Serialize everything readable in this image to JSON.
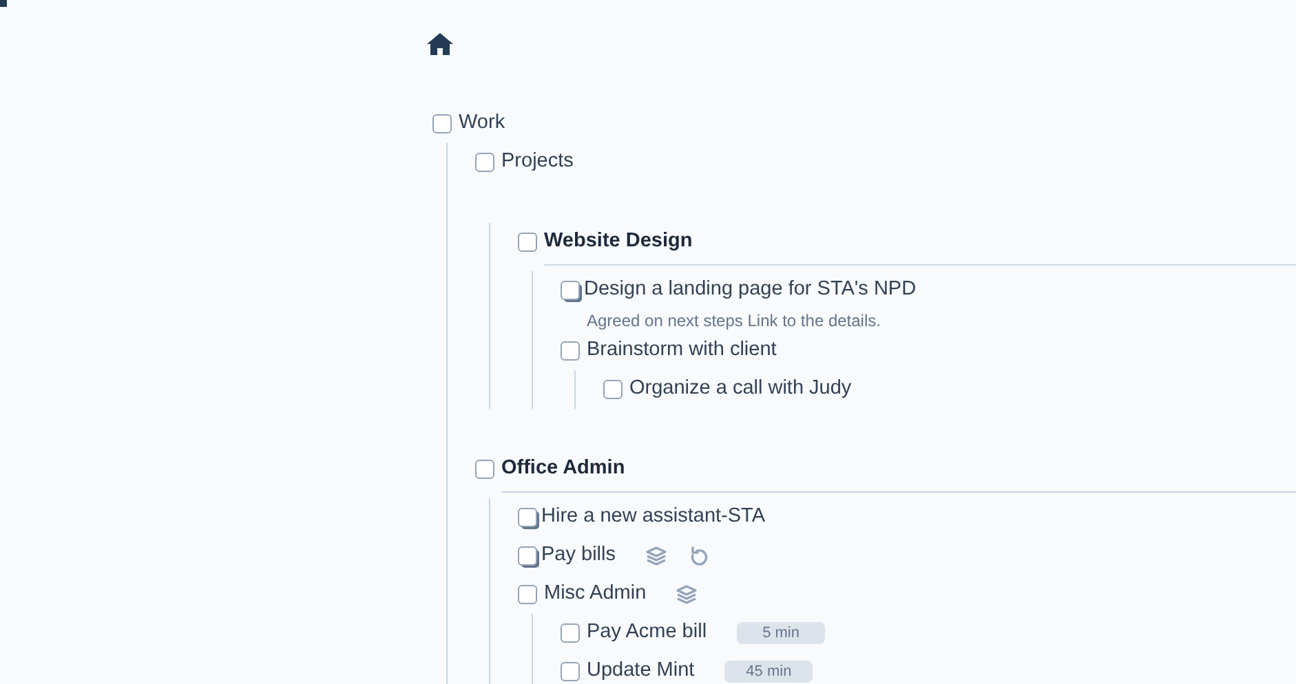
{
  "tree": [
    {
      "label": "Work",
      "kind": "task",
      "checked": false,
      "children": [
        {
          "label": "Projects",
          "kind": "task",
          "checked": false,
          "children": [
            {
              "label": "Website Design",
              "kind": "section",
              "checked": false,
              "children": [
                {
                  "label": "Design a landing page for STA's NPD",
                  "kind": "stacked_task",
                  "checked": false,
                  "note": "Agreed on next steps Link to the details."
                },
                {
                  "label": "Brainstorm with client",
                  "kind": "task",
                  "checked": false,
                  "children": [
                    {
                      "label": "Organize a call with Judy",
                      "kind": "task",
                      "checked": false
                    }
                  ]
                }
              ]
            }
          ]
        },
        {
          "label": "Office Admin",
          "kind": "section",
          "checked": false,
          "children": [
            {
              "label": "Hire a new assistant-STA",
              "kind": "stacked_task",
              "checked": false
            },
            {
              "label": "Pay bills",
              "kind": "stacked_task",
              "checked": false,
              "has_subtasks": true,
              "repeats": true
            },
            {
              "label": "Misc Admin",
              "kind": "task",
              "checked": false,
              "has_subtasks": true,
              "children": [
                {
                  "label": "Pay Acme bill",
                  "kind": "task",
                  "checked": false,
                  "duration": "5 min"
                },
                {
                  "label": "Update Mint",
                  "kind": "task",
                  "checked": false,
                  "duration": "45 min"
                }
              ]
            }
          ]
        }
      ]
    }
  ]
}
